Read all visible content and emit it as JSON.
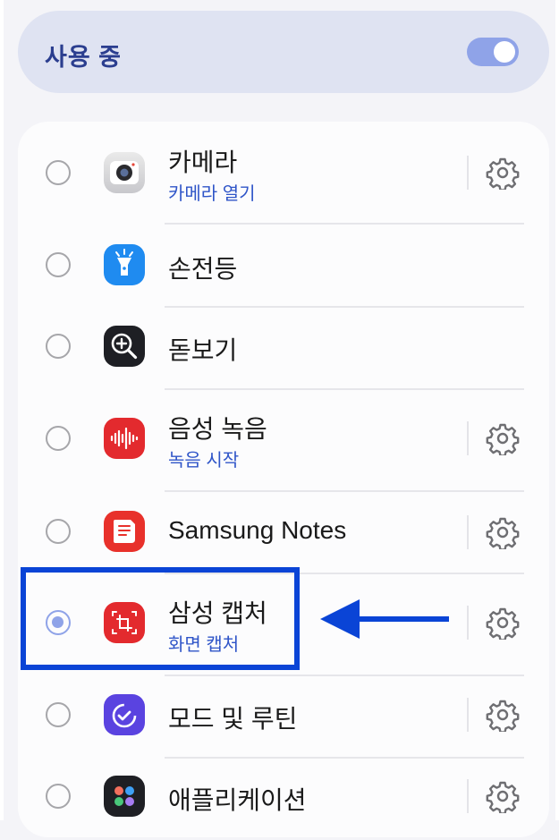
{
  "header": {
    "label": "사용 중",
    "toggle_on": true
  },
  "colors": {
    "accent": "#8fa3e8",
    "subtitle": "#2f55c8",
    "annotation": "#0a44d6"
  },
  "items": [
    {
      "title": "카메라",
      "subtitle": "카메라 열기",
      "icon": "camera-icon",
      "selected": false,
      "has_settings": true
    },
    {
      "title": "손전등",
      "subtitle": "",
      "icon": "flashlight-icon",
      "selected": false,
      "has_settings": false
    },
    {
      "title": "돋보기",
      "subtitle": "",
      "icon": "magnifier-icon",
      "selected": false,
      "has_settings": false
    },
    {
      "title": "음성 녹음",
      "subtitle": "녹음 시작",
      "icon": "voice-recorder-icon",
      "selected": false,
      "has_settings": true
    },
    {
      "title": "Samsung Notes",
      "subtitle": "",
      "icon": "samsung-notes-icon",
      "selected": false,
      "has_settings": true
    },
    {
      "title": "삼성 캡처",
      "subtitle": "화면 캡처",
      "icon": "samsung-capture-icon",
      "selected": true,
      "has_settings": true
    },
    {
      "title": "모드 및 루틴",
      "subtitle": "",
      "icon": "modes-routines-icon",
      "selected": false,
      "has_settings": true
    },
    {
      "title": "애플리케이션",
      "subtitle": "",
      "icon": "applications-icon",
      "selected": false,
      "has_settings": true
    }
  ]
}
